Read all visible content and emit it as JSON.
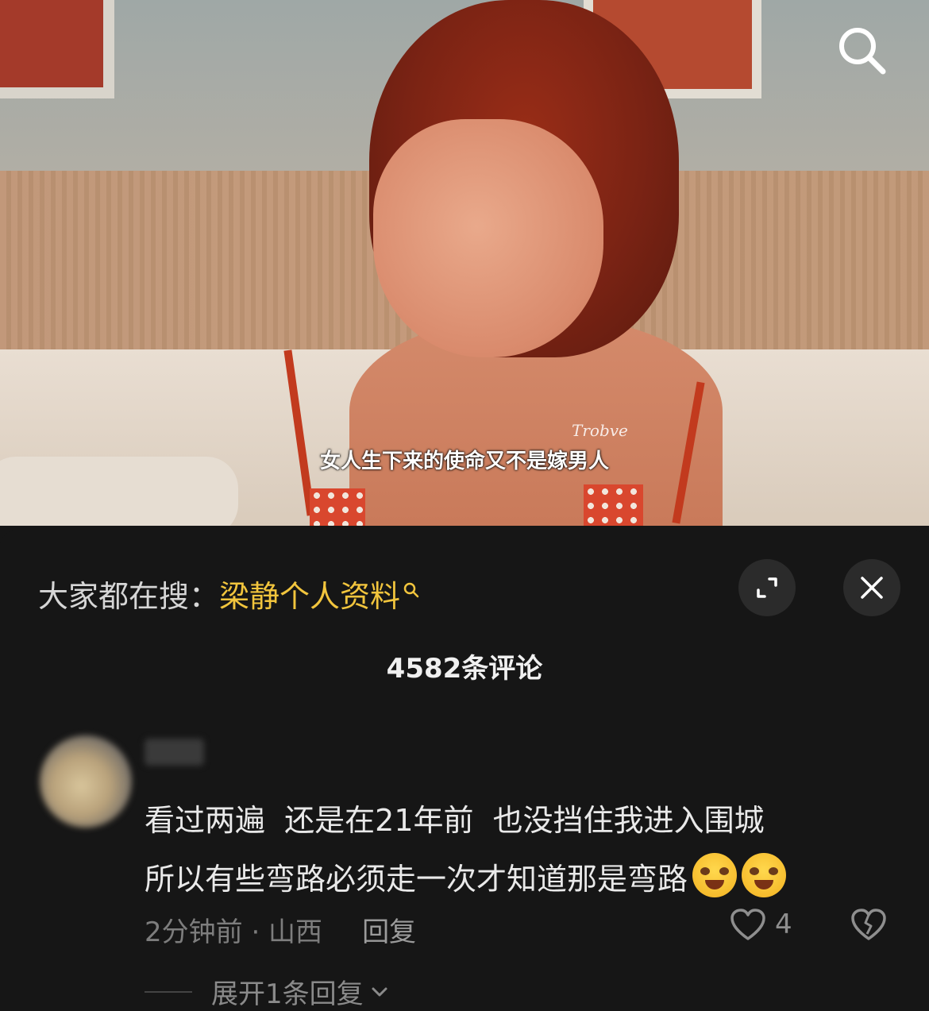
{
  "video": {
    "subtitle": "女人生下来的使命又不是嫁男人",
    "watermark": "Trobve"
  },
  "sheet": {
    "hot_search_prefix": "大家都在搜：",
    "hot_search_keyword": "梁静个人资料",
    "comments_count": "4582条评论"
  },
  "comment": {
    "lines": [
      "看过两遍  还是在21年前  也没挡住我进入围城",
      "所以有些弯路必须走一次才知道那是弯路"
    ],
    "time_location": "2分钟前 · 山西",
    "reply_label": "回复",
    "like_count": "4",
    "expand_replies": "展开1条回复"
  },
  "icons": {
    "search": "search-icon",
    "expand": "expand-icon",
    "close": "close-icon",
    "like": "heart-icon",
    "dislike": "broken-heart-icon",
    "emoji": "crying-face-emoji"
  },
  "colors": {
    "background": "#161616",
    "keyword": "#f2c53d"
  }
}
